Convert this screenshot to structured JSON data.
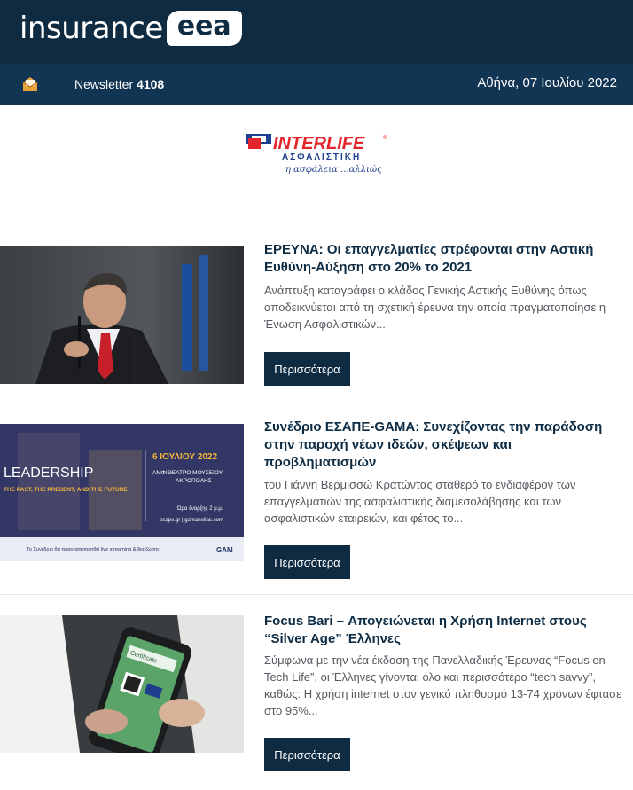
{
  "header": {
    "logo_word": "insurance",
    "logo_badge": "eea",
    "newsletter_label": "Newsletter",
    "newsletter_number": "4108",
    "date": "Αθήνα, 07 Ιουλίου 2022"
  },
  "sponsor": {
    "brand": "INTERLIFE",
    "sub": "ΑΣΦΑΛΙΣΤΙΚΗ",
    "tagline": "η ασφάλεια ...αλλιώς"
  },
  "articles": [
    {
      "title": "ΕΡΕΥΝΑ: Οι επαγγελματίες στρέφονται στην Αστική Ευθύνη-Αύξηση στο 20% το 2021",
      "excerpt": "Ανάπτυξη καταγράφει ο κλάδος Γενικής Αστικής Ευθύνης όπως αποδεικνύεται από τη σχετική έρευνα την οποία πραγματοποίησε η Ένωση Ασφαλιστικών...",
      "button": "Περισσότερα"
    },
    {
      "title": "Συνέδριο ΕΣΑΠΕ-GAMA: Συνεχίζοντας την παράδοση στην παροχή νέων ιδεών, σκέψεων και προβληματισμών",
      "excerpt": "του Γιάννη Βερμισσώ Κρατώντας σταθερό το ενδιαφέρον των επαγγελματιών της ασφαλιστικής διαμεσολάβησης και των ασφαλιστικών εταιρειών, και φέτος το...",
      "button": "Περισσότερα",
      "image_text": {
        "headline": "LEADERSHIP",
        "subline": "THE PAST, THE PRESENT, AND THE FUTURE",
        "date": "6 ΙΟΥΛΙΟΥ 2022",
        "venue1": "ΑΜΦΙΘΕΑΤΡΟ ΜΟΥΣΕΙΟΥ",
        "venue2": "ΑΚΡΟΠΟΛΗΣ",
        "time": "Ώρα έναρξης 2 μ.μ.",
        "sites": "esape.gr | gamanelias.com",
        "footer": "Το Συνέδριο θα πραγματοποιηθεί live streaming & δια ζώσης.",
        "brand": "GAM"
      }
    },
    {
      "title": "Focus Bari – Απογειώνεται η Χρήση Internet στους “Silver Age” Έλληνες",
      "excerpt": "Σύμφωνα με την νέα έκδοση της Πανελλαδικής Έρευνας “Focus on Tech Life”, οι Έλληνες γίνονται όλο και περισσότερο “tech savvy”, καθώς: Η χρήση internet στον γενικό πληθυσμό 13-74 χρόνων έφτασε στο 95%...",
      "button": "Περισσότερα",
      "image_text": {
        "card": "Certificate"
      }
    }
  ],
  "colors": {
    "header_bg": "#0e2b42",
    "subbar_bg": "#123553",
    "button_bg": "#0e2b42",
    "brand_red": "#e3262b"
  }
}
